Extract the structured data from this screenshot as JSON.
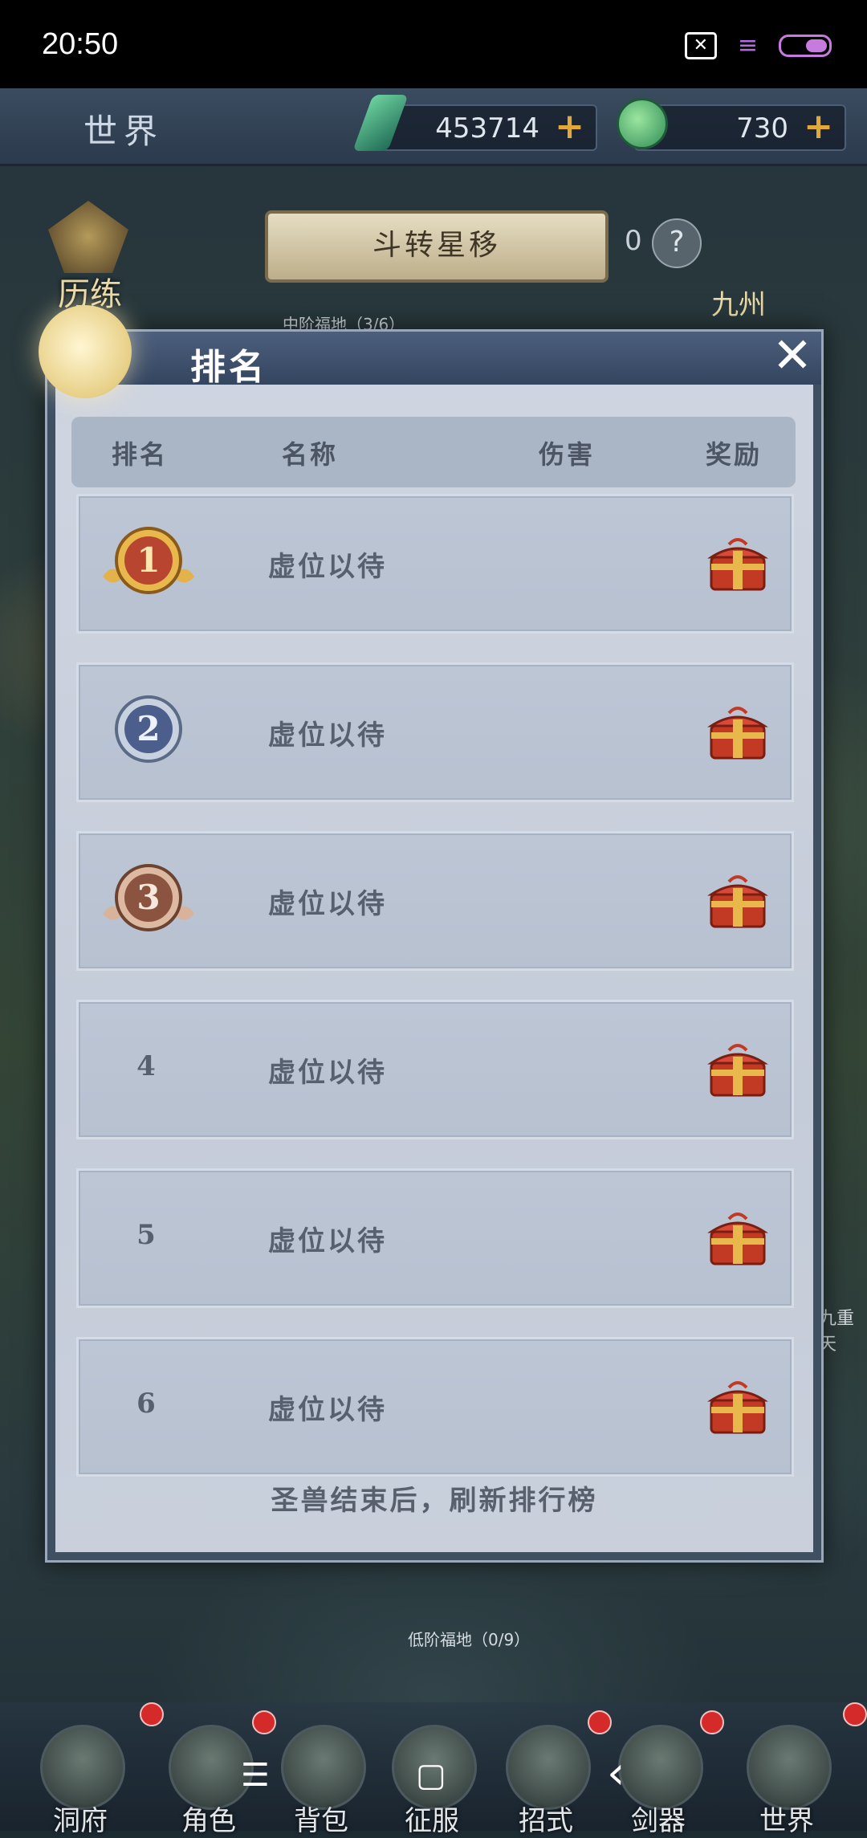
{
  "status_bar": {
    "time": "20:50",
    "icons": [
      "close-box-icon",
      "menu-lines-icon",
      "battery-icon"
    ]
  },
  "top_bar": {
    "title": "世界",
    "currencies": [
      {
        "icon": "gem-icon",
        "value": "453714",
        "plus": "+"
      },
      {
        "icon": "jade-icon",
        "value": "730",
        "plus": "+"
      }
    ]
  },
  "event": {
    "banner": "斗转星移",
    "count": "0",
    "help": "?"
  },
  "map_labels": {
    "training": "历练",
    "jiuzhou": "九州",
    "mid_land": "中阶福地（3/6）",
    "low_land": "低阶福地（0/9）",
    "side": "九重天"
  },
  "modal": {
    "title": "排名",
    "close": "✕",
    "columns": {
      "rank": "排名",
      "name": "名称",
      "damage": "伤害",
      "reward": "奖励"
    },
    "rows": [
      {
        "rank": "1",
        "name": "虚位以待",
        "damage": "",
        "medal": "gold"
      },
      {
        "rank": "2",
        "name": "虚位以待",
        "damage": "",
        "medal": "silver"
      },
      {
        "rank": "3",
        "name": "虚位以待",
        "damage": "",
        "medal": "bronze"
      },
      {
        "rank": "4",
        "name": "虚位以待",
        "damage": ""
      },
      {
        "rank": "5",
        "name": "虚位以待",
        "damage": ""
      },
      {
        "rank": "6",
        "name": "虚位以待",
        "damage": ""
      }
    ],
    "footer": "圣兽结束后，刷新排行榜"
  },
  "bottom_nav": [
    {
      "label": "洞府",
      "badge": true
    },
    {
      "label": "角色",
      "badge": false
    },
    {
      "label": "背包",
      "badge": true
    },
    {
      "label": "征服",
      "badge": false
    },
    {
      "label": "招式",
      "badge": true
    },
    {
      "label": "剑器",
      "badge": true
    },
    {
      "label": "世界",
      "badge": true
    }
  ],
  "system_nav": {
    "menu": "☰",
    "home": "▢",
    "back": "‹"
  },
  "colors": {
    "accent_gold": "#e0a93a",
    "badge_red": "#d42a2a",
    "modal_header": "#3b4e6a"
  }
}
